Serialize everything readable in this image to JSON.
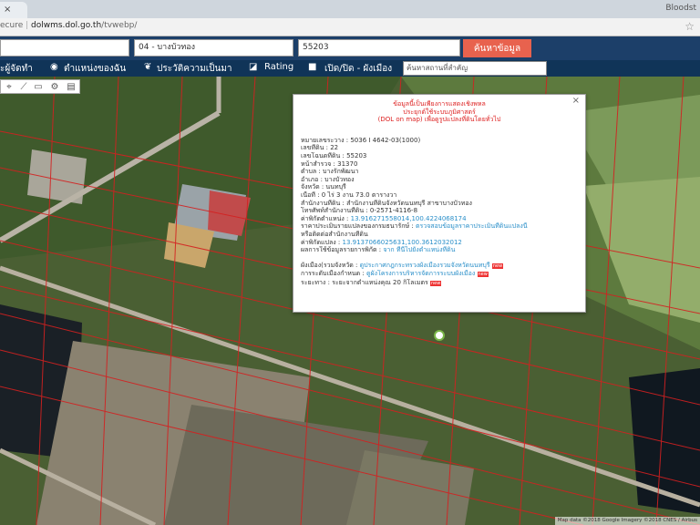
{
  "browser": {
    "tab_label": "×",
    "tab_right": "Bloodst",
    "url_prefix": "ecure",
    "url_host": "dolwms.dol.go.th",
    "url_path": "/tvwebp/"
  },
  "search": {
    "field1": "",
    "field2": "04 - บางบัวทอง",
    "field3": "55203",
    "button_label": "ค้นหาข้อมูล"
  },
  "menu": {
    "item1": "ะผู้จัดทำ",
    "item2": "ตำแหน่งของฉัน",
    "item3": "ประวัติความเป็นมา",
    "item4": "Rating",
    "item5": "เปิด/ปิด - ผังเมือง",
    "search_placeholder": "ค้นหาสถานที่สำคัญ"
  },
  "popup": {
    "close": "×",
    "notice1": "ข้อมูลนี้เป็นเพียงการแสดงเชิงพหล",
    "notice2": "ประยุกต์ใช้ระบบภูมิศาสตร์",
    "notice3": "(DOL on map) เพื่อดูรูปแปลงที่ดินโดยทั่วไป",
    "rows": [
      "หมายเลขระวาง : 5036 I 4642-03(1000)",
      "เลขที่ดิน : 22",
      "เลขโฉนดที่ดิน : 55203",
      "หน้าสำรวจ : 31370",
      "ตำบล : บางรักพัฒนา",
      "อำเภอ : บางบัวทอง",
      "จังหวัด : นนทบุรี",
      "เนื้อที่ : 0 ไร่ 3 งาน 73.0 ตารางวา",
      "สำนักงานที่ดิน : สำนักงานที่ดินจังหวัดนนทบุรี สาขาบางบัวทอง",
      "โทรศัพท์สำนักงานที่ดิน : 0-2571-4116-8"
    ],
    "coord_label": "ค่าพิกัดตำแหน่ง :",
    "coord_value": "13.916271558014,100.4224068174",
    "price_label": "ราคาประเมินรายแปลงของกรมธนารักษ์ :",
    "price_value": "ตรวจสอบข้อมูลราคาประเมินที่ดินแปลงนี้",
    "office_label": "หรือติดต่อสำนักงานที่ดิน",
    "coord2_label": "ค่าพิกัดแปลง :",
    "coord2_value": "13.9137066025631,100.3612032012",
    "zoning_label": "ผลการใช้ข้อมูลรายการพิกัด :",
    "zoning_value": "จาก ที่นี่ไปยังตำแหน่งที่ดิน",
    "plan_label": "ผังเมือง(รวมจังหวัด :",
    "plan_value": "ดูประกาศกฎกระทรวงผังเมืองรวมจังหวัดนนทบุรี",
    "land_label": "การระดับเมืองกำหนด :",
    "land_value": "ดูผังโครงการบริหารจัดการระบบผังเมือง",
    "distance": "ระยะทาง : ระยะจากตำแหน่งคุณ 20 กิโลเมตร",
    "new_badge": "new"
  },
  "map": {
    "attribution": "Map data ©2018 Google Imagery ©2018 CNES / Airbus"
  },
  "colors": {
    "header_blue": "#1c3f69",
    "menu_blue": "#103458",
    "search_button": "#e8624e",
    "parcel_lines": "#d42020"
  }
}
